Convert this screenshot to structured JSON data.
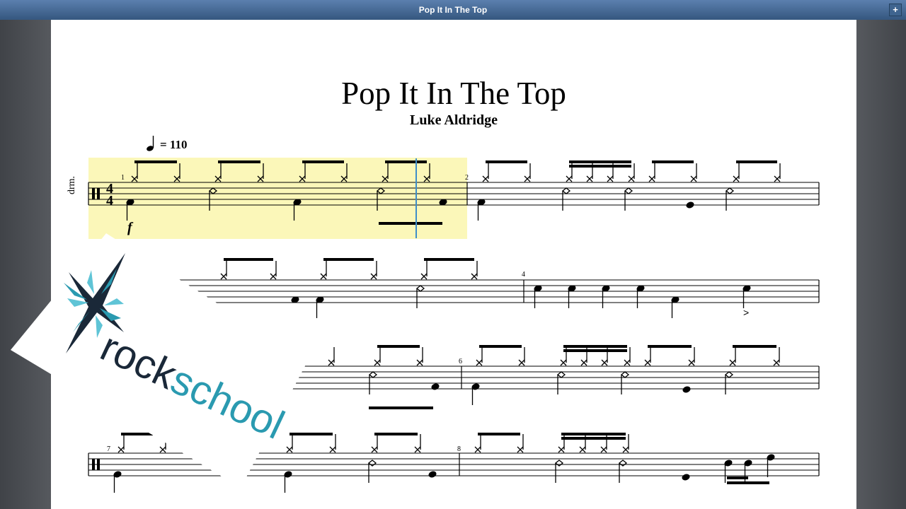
{
  "window": {
    "title": "Pop It In The Top",
    "plus_label": "+"
  },
  "score": {
    "title": "Pop It In The Top",
    "composer": "Luke Aldridge",
    "tempo_value": "= 110",
    "instrument_abbrev": "drm.",
    "time_signature": {
      "top": "4",
      "bottom": "4"
    },
    "dynamic": "f",
    "accent_mark": ">",
    "measure_numbers": [
      "1",
      "2",
      "4",
      "6",
      "7",
      "8"
    ]
  },
  "playback": {
    "highlight_measure": "1",
    "cursor_fraction_of_measure": 0.86
  },
  "logo": {
    "text": "rockschool",
    "primary_color": "#1a2838",
    "accent_color": "#2a9ab0"
  },
  "colors": {
    "highlight": "#fbf7b9",
    "cursor": "#3e8ec9",
    "titlebar": "#4a6f9c"
  }
}
